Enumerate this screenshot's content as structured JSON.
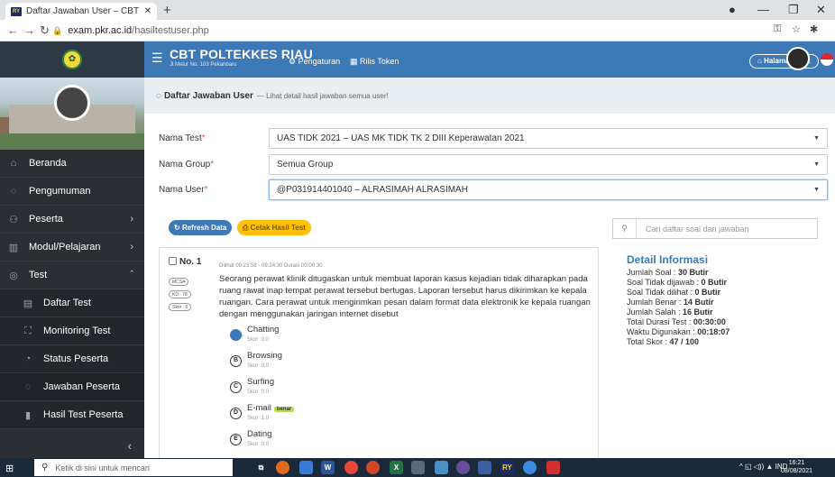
{
  "browser": {
    "tab_title": "Daftar Jawaban User – CBT POLTE",
    "tab_icon": "favicon-icon",
    "url_domain": "exam.pkr.ac.id",
    "url_path": "/hasiltestuser.php"
  },
  "header": {
    "brand": "CBT POLTEKKES RIAU",
    "address": "Jl.Melur No. 103 Pekanbaru",
    "nav_pengaturan": "Pengaturan",
    "nav_rilis": "Rilis Token",
    "halaman_test": "Halaman Test"
  },
  "sidebar": {
    "items": [
      {
        "label": "Beranda",
        "icon": "home-icon"
      },
      {
        "label": "Pengumuman",
        "icon": "announcement-icon"
      },
      {
        "label": "Peserta",
        "icon": "users-icon"
      },
      {
        "label": "Modul/Pelajaran",
        "icon": "book-icon"
      },
      {
        "label": "Test",
        "icon": "test-icon"
      },
      {
        "label": "Daftar Test",
        "icon": "list-icon"
      },
      {
        "label": "Monitoring Test",
        "icon": "monitor-icon"
      },
      {
        "label": "Status Peserta",
        "icon": "status-icon"
      },
      {
        "label": "Jawaban Peserta",
        "icon": "answers-icon"
      },
      {
        "label": "Hasil Test Peserta",
        "icon": "chart-icon"
      }
    ]
  },
  "page": {
    "title": "Daftar Jawaban User",
    "subtitle": "Lihat detail hasil jawaban semua user!"
  },
  "form": {
    "test_label": "Nama Test",
    "test_value": "UAS TIDK 2021 – UAS MK TIDK TK 2 DIII Keperawatan 2021",
    "group_label": "Nama Group",
    "group_value": "Semua Group",
    "user_label": "Nama User",
    "user_value": "@P031914401040 – ALRASIMAH ALRASIMAH"
  },
  "buttons": {
    "refresh": "Refresh Data",
    "cetak": "Cetak Hasil Test"
  },
  "search": {
    "placeholder": "Cari daftar soal dan jawaban"
  },
  "question": {
    "number": "No. 1",
    "tag_type": "MCSA",
    "tag_kd": "KD : 78",
    "tag_skor": "Skor : 0",
    "meta": "Dilihat 09:23:58 - 09:24:30 Durasi 00:00:30",
    "text": "Seorang perawat klinik ditugaskan untuk membuat laporan kasus kejadian tidak diharapkan pada ruang rawat inap tempat perawat tersebut bertugas. Laporan tersebut harus dikirimkan ke kepala ruangan. Cara perawat untuk mengirimkan pesan dalam format data elektronik ke kepala ruangan dengan menggunakan jaringan internet disebut",
    "options": [
      {
        "letter": "A",
        "text": "Chatting",
        "skor": "Skor :0.0",
        "selected": true
      },
      {
        "letter": "B",
        "text": "Browsing",
        "skor": "Skor :0.0"
      },
      {
        "letter": "C",
        "text": "Surfing",
        "skor": "Skor :0.0"
      },
      {
        "letter": "D",
        "text": "E-mail",
        "skor": "Skor :1.0",
        "badge": "benar"
      },
      {
        "letter": "E",
        "text": "Dating",
        "skor": "Skor :0.0"
      }
    ]
  },
  "detail": {
    "title": "Detail Informasi",
    "jumlah_soal_label": "Jumlah Soal : ",
    "jumlah_soal": "30 Butir",
    "tidak_dijawab_label": "Soal Tidak dijawab : ",
    "tidak_dijawab": "0 Butir",
    "tidak_dilihat_label": "Soal Tidak dilihat : ",
    "tidak_dilihat": "0 Butir",
    "benar_label": "Jumlah Benar : ",
    "benar": "14 Butir",
    "salah_label": "Jumlah Salah : ",
    "salah": "16 Butir",
    "durasi_label": "Total Durasi Test : ",
    "durasi": "00:30:00",
    "digunakan_label": "Waktu Digunakan : ",
    "digunakan": "00:18:07",
    "skor_label": "Total Skor : ",
    "skor": "47 / 100"
  },
  "taskbar": {
    "search_placeholder": "Ketik di sini untuk mencari",
    "lang": "IND",
    "time": "16:21",
    "date": "08/08/2021"
  },
  "colors": {
    "primary": "#3d79b6",
    "sidebar": "#2b2f33",
    "warning": "#ffc107"
  }
}
